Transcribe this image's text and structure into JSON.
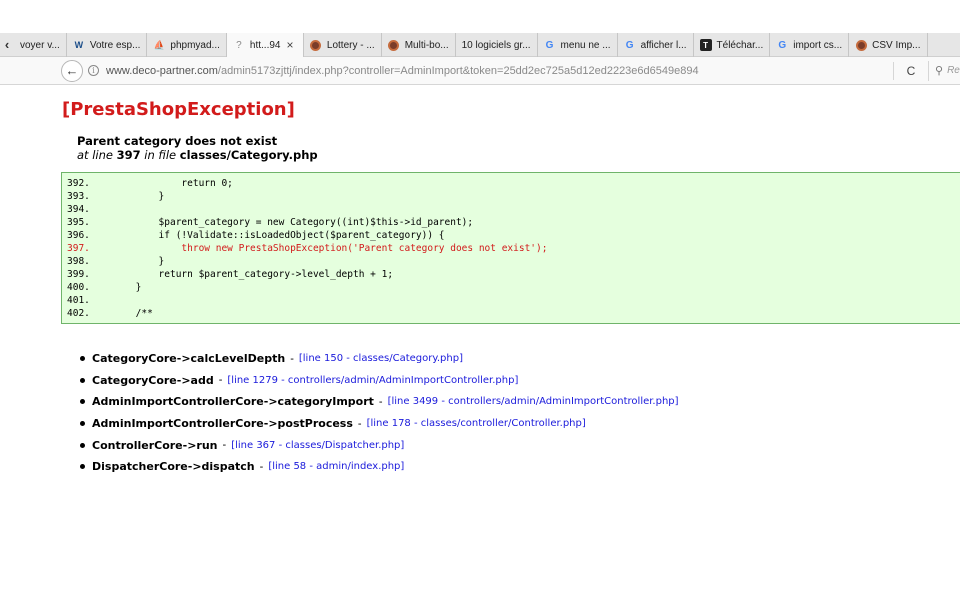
{
  "browser": {
    "tab_scroll_symbol": "‹",
    "tabs": [
      {
        "label": "voyer v...",
        "icon": ""
      },
      {
        "label": "Votre esp...",
        "icon": "W"
      },
      {
        "label": "phpmyad...",
        "icon": "pma"
      },
      {
        "label": "htt...94",
        "icon": "?"
      },
      {
        "label": "Lottery - ...",
        "icon": "mozilla"
      },
      {
        "label": "Multi-bo...",
        "icon": "mozilla"
      },
      {
        "label": "10 logiciels gr...",
        "icon": ""
      },
      {
        "label": "menu ne ...",
        "icon": "G"
      },
      {
        "label": "afficher l...",
        "icon": "G"
      },
      {
        "label": "Téléchar...",
        "icon": "T"
      },
      {
        "label": "import cs...",
        "icon": "G"
      },
      {
        "label": "CSV Imp...",
        "icon": "mozilla"
      }
    ],
    "active_tab_close": "×",
    "back_symbol": "←",
    "info_symbol": "i",
    "url_host": "www.deco-partner.com",
    "url_path": "/admin5173zjttj/index.php?controller=AdminImport&token=25dd2ec725a5d12ed2223e6d6549e894",
    "reload_symbol": "C",
    "search_placeholder": "Re",
    "search_symbol": "⚲"
  },
  "exception": {
    "title": "[PrestaShopException]",
    "message": "Parent category does not exist",
    "at_line_text": "at line",
    "line_number": "397",
    "in_file_text": "in file",
    "file": "classes/Category.php"
  },
  "code": [
    {
      "num": "392.",
      "code": "            return 0;",
      "error": false
    },
    {
      "num": "393.",
      "code": "        }",
      "error": false
    },
    {
      "num": "394.",
      "code": "",
      "error": false
    },
    {
      "num": "395.",
      "code": "        $parent_category = new Category((int)$this->id_parent);",
      "error": false
    },
    {
      "num": "396.",
      "code": "        if (!Validate::isLoadedObject($parent_category)) {",
      "error": false
    },
    {
      "num": "397.",
      "code": "            throw new PrestaShopException('Parent category does not exist');",
      "error": true
    },
    {
      "num": "398.",
      "code": "        }",
      "error": false
    },
    {
      "num": "399.",
      "code": "        return $parent_category->level_depth + 1;",
      "error": false
    },
    {
      "num": "400.",
      "code": "    }",
      "error": false
    },
    {
      "num": "401.",
      "code": "",
      "error": false
    },
    {
      "num": "402.",
      "code": "    /**",
      "error": false
    }
  ],
  "trace": [
    {
      "fn": "CategoryCore->calcLevelDepth",
      "loc": "[line 150 - classes/Category.php]"
    },
    {
      "fn": "CategoryCore->add",
      "loc": "[line 1279 - controllers/admin/AdminImportController.php]"
    },
    {
      "fn": "AdminImportControllerCore->categoryImport",
      "loc": "[line 3499 - controllers/admin/AdminImportController.php]"
    },
    {
      "fn": "AdminImportControllerCore->postProcess",
      "loc": "[line 178 - classes/controller/Controller.php]"
    },
    {
      "fn": "ControllerCore->run",
      "loc": "[line 367 - classes/Dispatcher.php]"
    },
    {
      "fn": "DispatcherCore->dispatch",
      "loc": "[line 58 - admin/index.php]"
    }
  ],
  "trace_separator": "-",
  "colors": {
    "error_red": "#d21b1b",
    "link_blue": "#1a1adb",
    "code_bg": "#e5ffde",
    "code_border": "#6fb46a"
  }
}
